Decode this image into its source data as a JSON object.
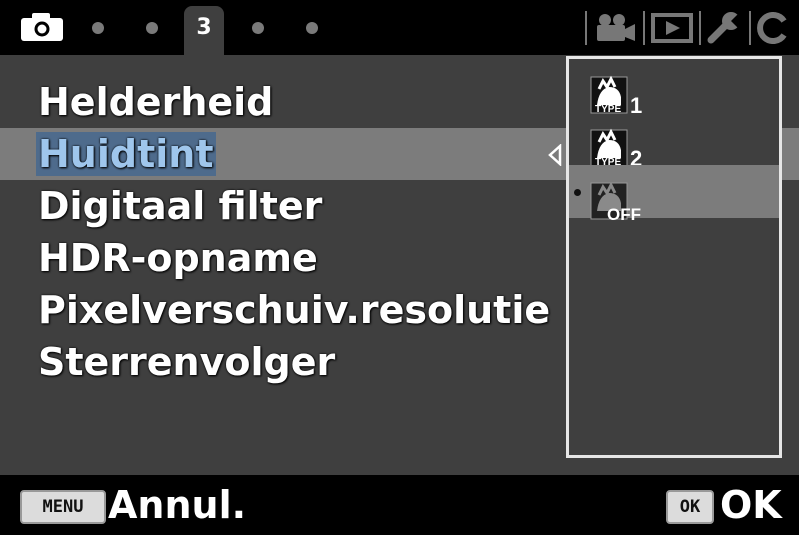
{
  "tabs": {
    "active_label": "3"
  },
  "menu": {
    "items": [
      {
        "label": "Helderheid"
      },
      {
        "label": "Huidtint"
      },
      {
        "label": "Digitaal filter"
      },
      {
        "label": "HDR-opname"
      },
      {
        "label": "Pixelverschuiv.resolutie"
      },
      {
        "label": "Sterrenvolger"
      }
    ],
    "selected_index": 1
  },
  "options_panel": {
    "items": [
      {
        "icon": "skin-tone-type1-icon",
        "label": "TYPE 1"
      },
      {
        "icon": "skin-tone-type2-icon",
        "label": "TYPE 2"
      },
      {
        "icon": "skin-tone-off-icon",
        "label": "OFF"
      }
    ],
    "current_index": 2
  },
  "bottom": {
    "menu_key": "MENU",
    "cancel_label": "Annul.",
    "ok_key": "OK",
    "ok_label": "OK"
  },
  "colors": {
    "background": "#3f3f3f",
    "bar": "#000000",
    "highlight_row": "#7c7c7c",
    "selected_text": "#9fc6ec"
  }
}
